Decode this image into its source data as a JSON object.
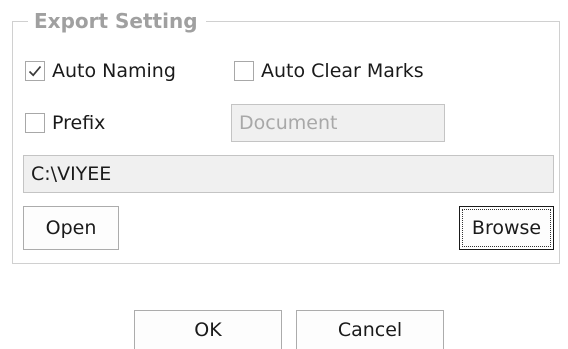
{
  "export_setting": {
    "title": "Export Setting",
    "auto_naming": {
      "label": "Auto Naming",
      "checked": true
    },
    "auto_clear_marks": {
      "label": "Auto Clear Marks",
      "checked": false
    },
    "prefix": {
      "label": "Prefix",
      "checked": false,
      "value": "Document"
    },
    "path": {
      "value": "C:\\VIYEE"
    },
    "open_label": "Open",
    "browse_label": "Browse"
  },
  "dialog": {
    "ok_label": "OK",
    "cancel_label": "Cancel"
  },
  "icons": {
    "checkmark": "checkmark-icon"
  },
  "colors": {
    "group_title": "#a0a0a0",
    "disabled_text": "#a8a8a8",
    "input_bg": "#f0f0f0"
  }
}
